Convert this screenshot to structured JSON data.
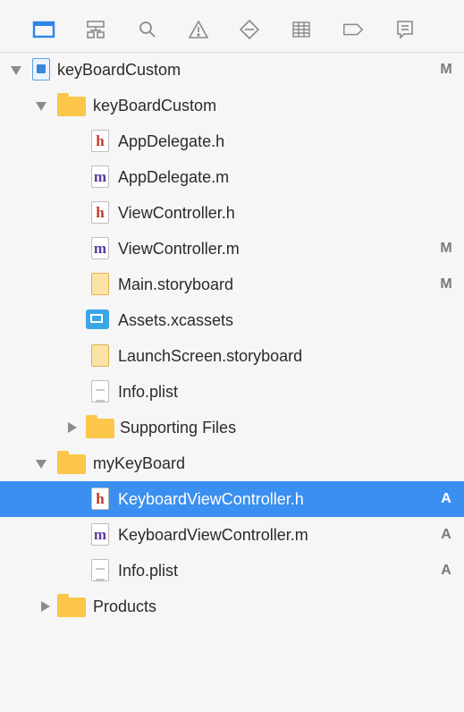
{
  "toolbar": {
    "icons": [
      {
        "name": "project-navigator-icon",
        "selected": true
      },
      {
        "name": "symbol-navigator-icon"
      },
      {
        "name": "find-navigator-icon"
      },
      {
        "name": "issue-navigator-icon"
      },
      {
        "name": "test-navigator-icon"
      },
      {
        "name": "debug-navigator-icon"
      },
      {
        "name": "breakpoint-navigator-icon"
      },
      {
        "name": "report-navigator-icon"
      }
    ],
    "accent": "#3b8ff0"
  },
  "tree": {
    "items": [
      {
        "label": "keyBoardCustom",
        "badge": "M",
        "icon": "project-file-icon",
        "expanded": true
      },
      {
        "label": "keyBoardCustom",
        "badge": "",
        "icon": "folder-icon",
        "expanded": true
      },
      {
        "label": "AppDelegate.h",
        "badge": "",
        "icon": "header-file-icon",
        "icon_letter": "h"
      },
      {
        "label": "AppDelegate.m",
        "badge": "",
        "icon": "objc-file-icon",
        "icon_letter": "m"
      },
      {
        "label": "ViewController.h",
        "badge": "",
        "icon": "header-file-icon",
        "icon_letter": "h"
      },
      {
        "label": "ViewController.m",
        "badge": "M",
        "icon": "objc-file-icon",
        "icon_letter": "m"
      },
      {
        "label": "Main.storyboard",
        "badge": "M",
        "icon": "storyboard-file-icon"
      },
      {
        "label": "Assets.xcassets",
        "badge": "",
        "icon": "asset-catalog-icon"
      },
      {
        "label": "LaunchScreen.storyboard",
        "badge": "",
        "icon": "storyboard-file-icon"
      },
      {
        "label": "Info.plist",
        "badge": "",
        "icon": "plist-file-icon"
      },
      {
        "label": "Supporting Files",
        "badge": "",
        "icon": "folder-icon",
        "expanded": false
      },
      {
        "label": "myKeyBoard",
        "badge": "",
        "icon": "folder-icon",
        "expanded": true
      },
      {
        "label": "KeyboardViewController.h",
        "badge": "A",
        "icon": "header-file-icon",
        "icon_letter": "h",
        "selected": true
      },
      {
        "label": "KeyboardViewController.m",
        "badge": "A",
        "icon": "objc-file-icon",
        "icon_letter": "m"
      },
      {
        "label": "Info.plist",
        "badge": "A",
        "icon": "plist-file-icon"
      },
      {
        "label": "Products",
        "badge": "",
        "icon": "folder-icon",
        "expanded": false
      }
    ],
    "selection_color": "#3b8ff0"
  }
}
